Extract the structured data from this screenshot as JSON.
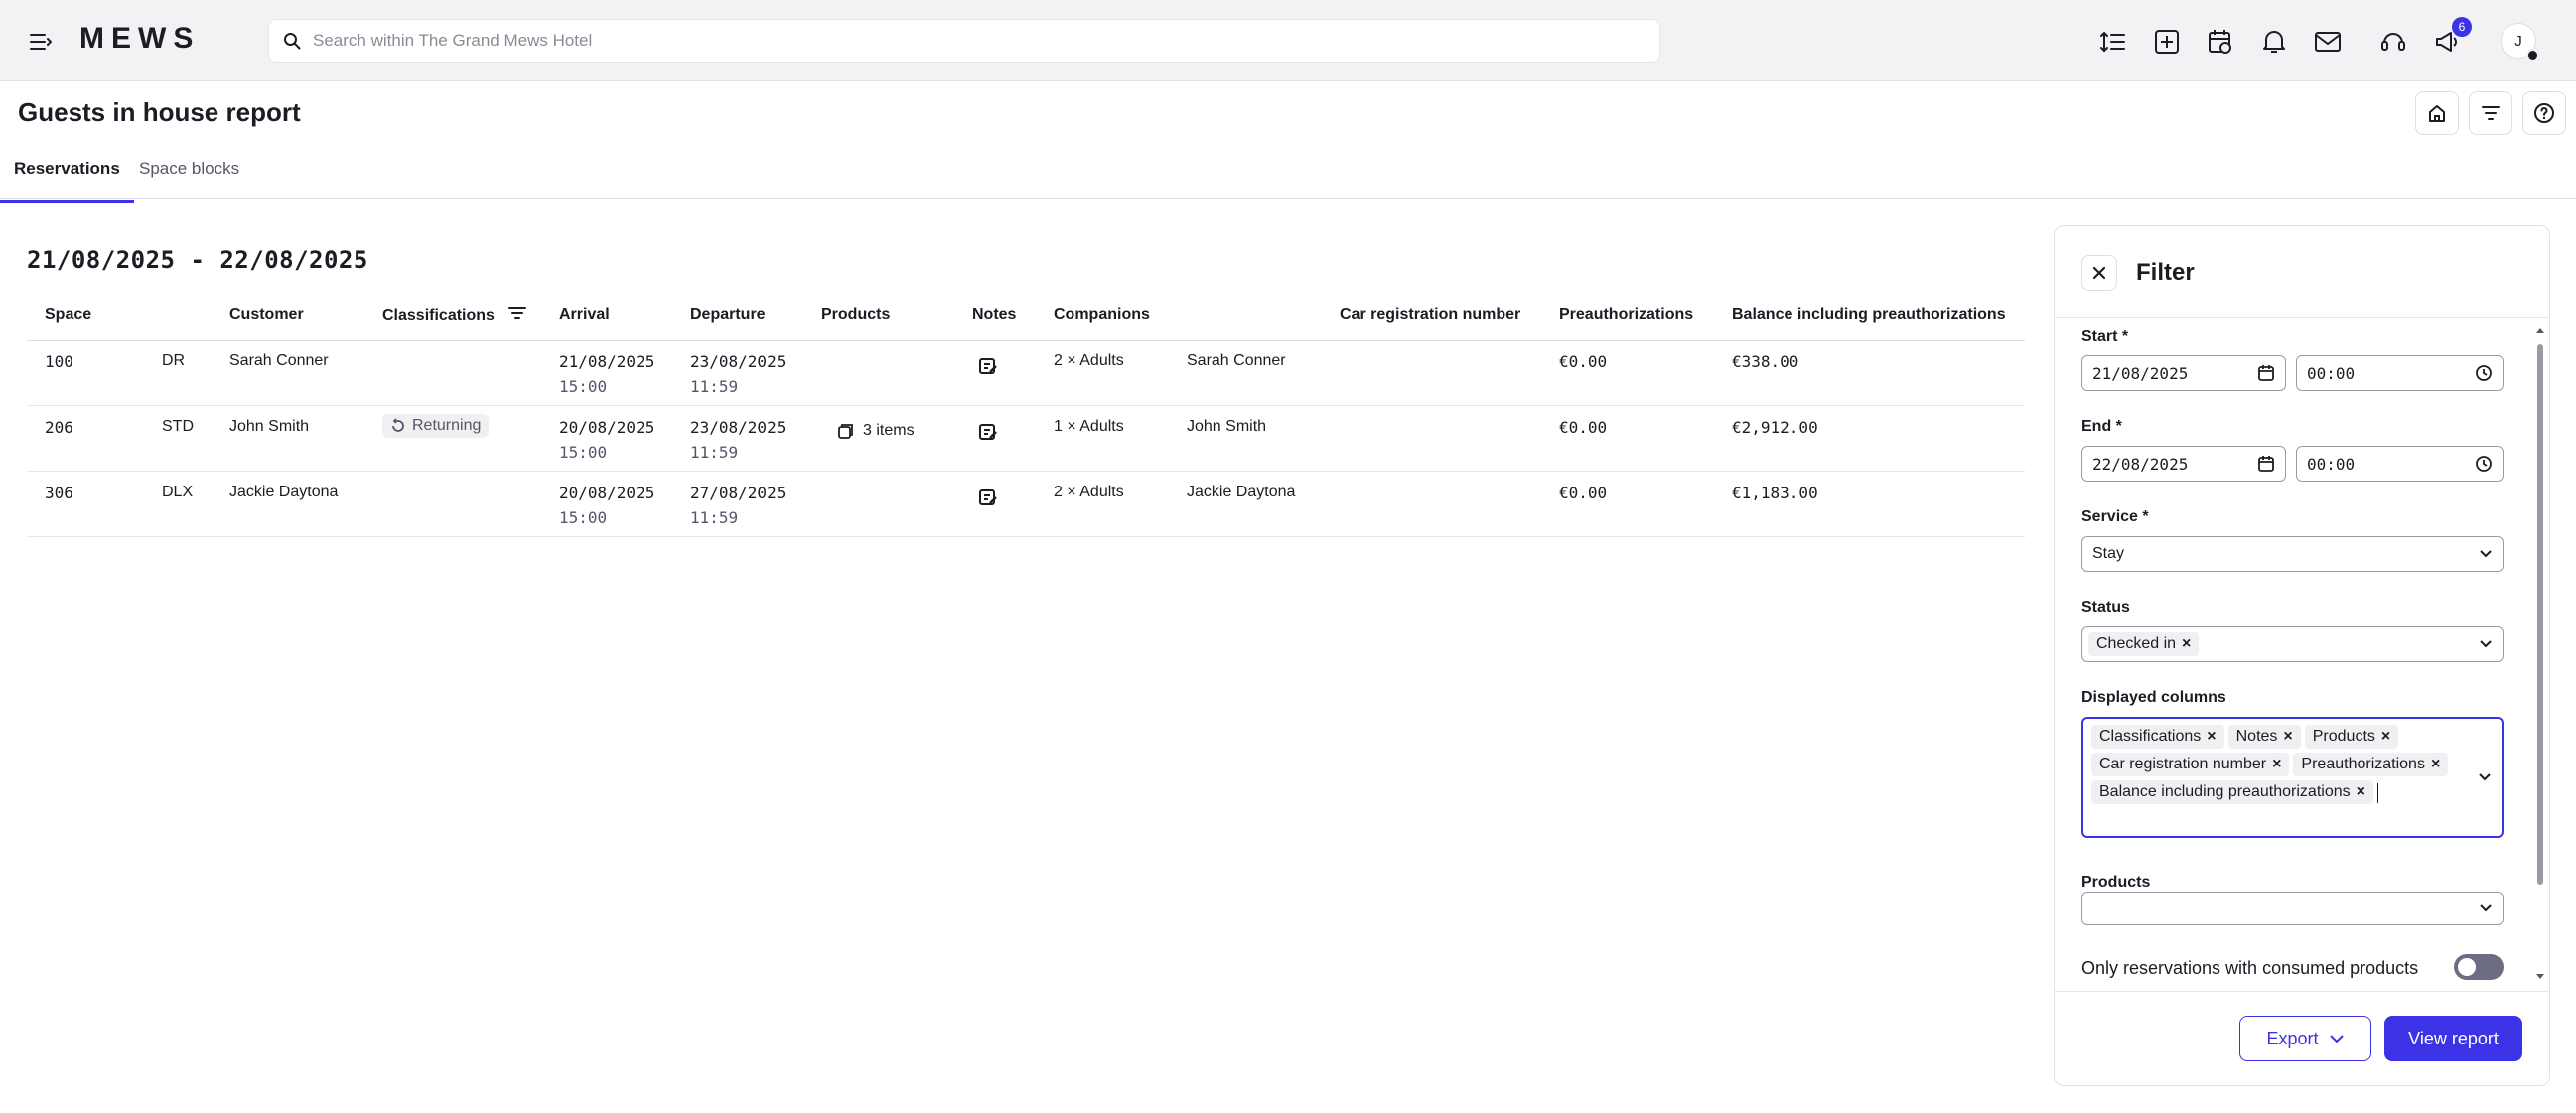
{
  "app": {
    "logo": "MEWS",
    "search_placeholder": "Search within The Grand Mews Hotel",
    "notification_count": "6",
    "avatar_initial": "J"
  },
  "page": {
    "title": "Guests in house report",
    "tabs": [
      {
        "label": "Reservations",
        "active": true
      },
      {
        "label": "Space blocks",
        "active": false
      }
    ]
  },
  "report": {
    "date_range": "21/08/2025 - 22/08/2025",
    "columns": {
      "space": "Space",
      "customer": "Customer",
      "classifications": "Classifications",
      "arrival": "Arrival",
      "departure": "Departure",
      "products": "Products",
      "notes": "Notes",
      "companions": "Companions",
      "car_registration": "Car registration number",
      "preauthorizations": "Preauthorizations",
      "balance": "Balance including preauthorizations"
    },
    "rows": [
      {
        "space": "100",
        "space_type": "DR",
        "customer": "Sarah Conner",
        "classification": "",
        "arrival_date": "21/08/2025",
        "arrival_time": "15:00",
        "departure_date": "23/08/2025",
        "departure_time": "11:59",
        "products": "",
        "companions": "2 × Adults",
        "companion_name": "Sarah Conner",
        "car": "",
        "preauth": "€0.00",
        "balance": "€338.00"
      },
      {
        "space": "206",
        "space_type": "STD",
        "customer": "John Smith",
        "classification": "Returning",
        "arrival_date": "20/08/2025",
        "arrival_time": "15:00",
        "departure_date": "23/08/2025",
        "departure_time": "11:59",
        "products": "3 items",
        "companions": "1 × Adults",
        "companion_name": "John Smith",
        "car": "",
        "preauth": "€0.00",
        "balance": "€2,912.00"
      },
      {
        "space": "306",
        "space_type": "DLX",
        "customer": "Jackie Daytona",
        "classification": "",
        "arrival_date": "20/08/2025",
        "arrival_time": "15:00",
        "departure_date": "27/08/2025",
        "departure_time": "11:59",
        "products": "",
        "companions": "2 × Adults",
        "companion_name": "Jackie Daytona",
        "car": "",
        "preauth": "€0.00",
        "balance": "€1,183.00"
      }
    ]
  },
  "filter": {
    "title": "Filter",
    "start_label": "Start *",
    "start_date": "21/08/2025",
    "start_time": "00:00",
    "end_label": "End *",
    "end_date": "22/08/2025",
    "end_time": "00:00",
    "service_label": "Service *",
    "service_value": "Stay",
    "status_label": "Status",
    "status_tags": [
      "Checked in"
    ],
    "columns_label": "Displayed columns",
    "column_tags": [
      "Classifications",
      "Notes",
      "Products",
      "Car registration number",
      "Preauthorizations",
      "Balance including preauthorizations"
    ],
    "products_label": "Products",
    "products_value": "",
    "consumed_label": "Only reservations with consumed products",
    "consumed_on": false,
    "export_label": "Export",
    "view_label": "View report"
  },
  "colors": {
    "accent": "#3c33e6",
    "topbar": "#f2f2f4"
  }
}
